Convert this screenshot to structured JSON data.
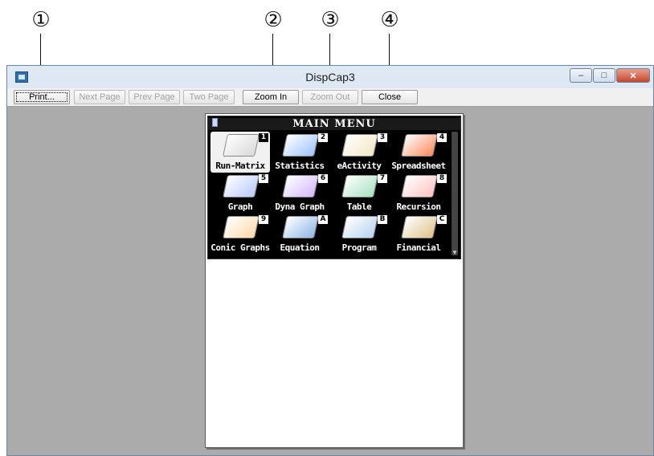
{
  "callouts": [
    "①",
    "②",
    "③",
    "④"
  ],
  "window": {
    "title": "DispCap3",
    "minimize": "–",
    "maximize": "□",
    "close": "✕"
  },
  "toolbar": {
    "print": "Print...",
    "next_page": "Next Page",
    "prev_page": "Prev Page",
    "two_page": "Two Page",
    "zoom_in": "Zoom In",
    "zoom_out": "Zoom Out",
    "close": "Close"
  },
  "calc": {
    "title": "MAIN MENU",
    "items": [
      {
        "label": "Run-Matrix",
        "key": "1",
        "icon": "run-matrix-icon",
        "color": "#d9d9d9",
        "selected": true
      },
      {
        "label": "Statistics",
        "key": "2",
        "icon": "statistics-icon",
        "color": "#9cc3ff"
      },
      {
        "label": "eActivity",
        "key": "3",
        "icon": "eactivity-icon",
        "color": "#f2e6c4"
      },
      {
        "label": "Spreadsheet",
        "key": "4",
        "icon": "spreadsheet-icon",
        "color": "#ff8b5c"
      },
      {
        "label": "Graph",
        "key": "5",
        "icon": "graph-icon",
        "color": "#b8c9ff"
      },
      {
        "label": "Dyna Graph",
        "key": "6",
        "icon": "dyna-graph-icon",
        "color": "#d4b8ff"
      },
      {
        "label": "Table",
        "key": "7",
        "icon": "table-icon",
        "color": "#a8e0c0"
      },
      {
        "label": "Recursion",
        "key": "8",
        "icon": "recursion-icon",
        "color": "#ffc2c2"
      },
      {
        "label": "Conic Graphs",
        "key": "9",
        "icon": "conic-graphs-icon",
        "color": "#ffd9a8"
      },
      {
        "label": "Equation",
        "key": "A",
        "icon": "equation-icon",
        "color": "#8fb7e6"
      },
      {
        "label": "Program",
        "key": "B",
        "icon": "program-icon",
        "color": "#b9d3f0"
      },
      {
        "label": "Financial",
        "key": "C",
        "icon": "financial-icon",
        "color": "#e0c28a"
      }
    ],
    "scroll_arrow": "▼"
  }
}
